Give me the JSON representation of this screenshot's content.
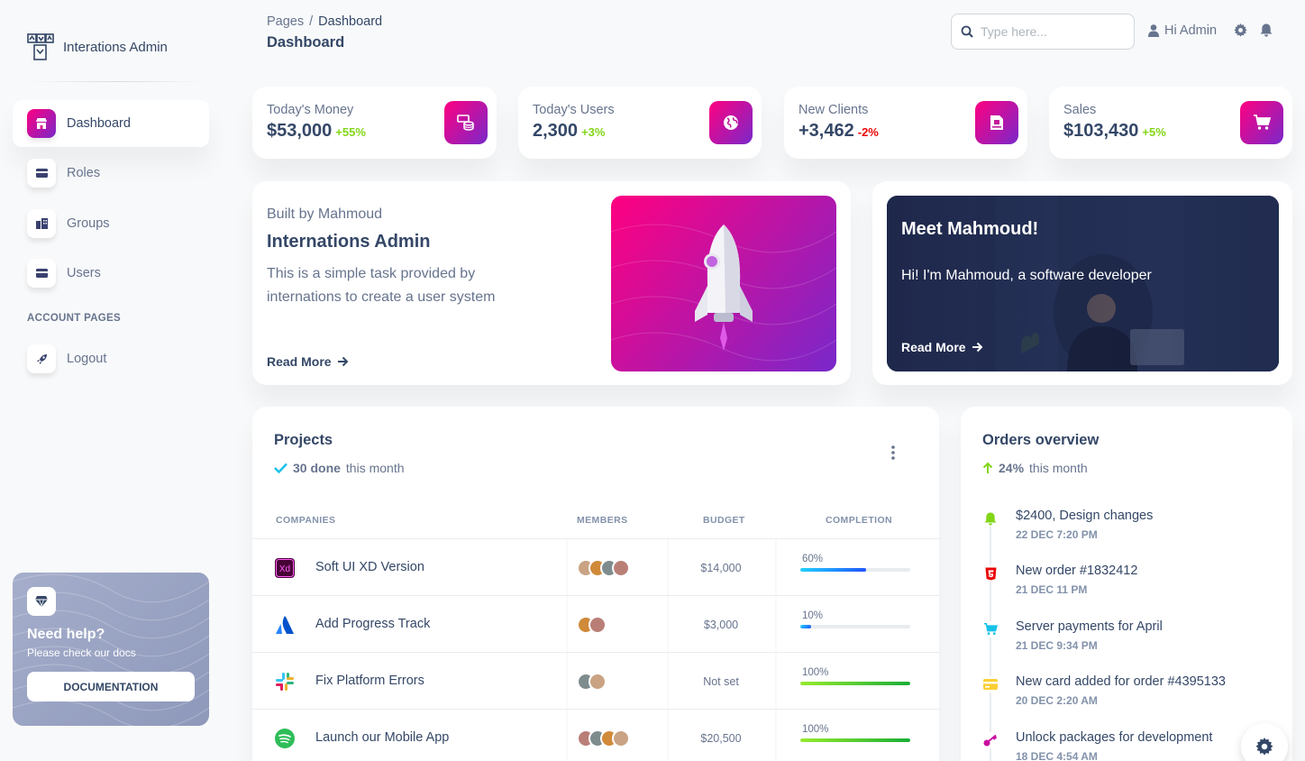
{
  "brand": {
    "name": "Interations Admin",
    "icon": "grid-logo-icon"
  },
  "sidebar": {
    "items": [
      {
        "label": "Dashboard",
        "icon": "shop-icon",
        "active": true
      },
      {
        "label": "Roles",
        "icon": "credit-card-icon",
        "active": false
      },
      {
        "label": "Groups",
        "icon": "office-building-icon",
        "active": false
      },
      {
        "label": "Users",
        "icon": "credit-card-icon",
        "active": false
      }
    ],
    "section_label": "ACCOUNT PAGES",
    "account_items": [
      {
        "label": "Logout",
        "icon": "rocket-icon"
      }
    ],
    "help": {
      "title": "Need help?",
      "subtitle": "Please check our docs",
      "button": "DOCUMENTATION",
      "icon": "diamond-icon"
    }
  },
  "header": {
    "breadcrumb_root": "Pages",
    "breadcrumb_sep": "/",
    "breadcrumb_current": "Dashboard",
    "title": "Dashboard",
    "search_placeholder": "Type here...",
    "user_label": "Hi Admin"
  },
  "stats": [
    {
      "title": "Today's Money",
      "value": "$53,000",
      "change": "+55%",
      "positive": true,
      "icon": "money-icon"
    },
    {
      "title": "Today's Users",
      "value": "2,300",
      "change": "+3%",
      "positive": true,
      "icon": "globe-icon"
    },
    {
      "title": "New Clients",
      "value": "+3,462",
      "change": "-2%",
      "positive": false,
      "icon": "document-icon"
    },
    {
      "title": "Sales",
      "value": "$103,430",
      "change": "+5%",
      "positive": true,
      "icon": "cart-icon"
    }
  ],
  "built": {
    "subtitle": "Built by Mahmoud",
    "title": "Internations Admin",
    "description": "This is a simple task provided by internations to create a user system",
    "link": "Read More"
  },
  "meet": {
    "title": "Meet Mahmoud!",
    "description": "Hi! I'm Mahmoud, a software developer",
    "link": "Read More"
  },
  "projects": {
    "title": "Projects",
    "done_count": "30 done",
    "done_suffix": "this month",
    "columns": [
      "COMPANIES",
      "MEMBERS",
      "BUDGET",
      "COMPLETION"
    ],
    "rows": [
      {
        "name": "Soft UI XD Version",
        "logo": "adobe-xd-icon",
        "members": 4,
        "budget": "$14,000",
        "completion": "60%",
        "progress": 0.6,
        "color": "blue"
      },
      {
        "name": "Add Progress Track",
        "logo": "atlassian-icon",
        "members": 2,
        "budget": "$3,000",
        "completion": "10%",
        "progress": 0.1,
        "color": "blue"
      },
      {
        "name": "Fix Platform Errors",
        "logo": "slack-icon",
        "members": 2,
        "budget": "Not set",
        "completion": "100%",
        "progress": 1.0,
        "color": "green"
      },
      {
        "name": "Launch our Mobile App",
        "logo": "spotify-icon",
        "members": 4,
        "budget": "$20,500",
        "completion": "100%",
        "progress": 1.0,
        "color": "green"
      }
    ]
  },
  "orders": {
    "title": "Orders overview",
    "change": "24%",
    "change_suffix": "this month",
    "items": [
      {
        "title": "$2400, Design changes",
        "date": "22 DEC 7:20 PM",
        "icon": "bell-icon",
        "color": "#82d616"
      },
      {
        "title": "New order #1832412",
        "date": "21 DEC 11 PM",
        "icon": "html5-icon",
        "color": "#ea0606"
      },
      {
        "title": "Server payments for April",
        "date": "21 DEC 9:34 PM",
        "icon": "cart-icon",
        "color": "#17c1e8"
      },
      {
        "title": "New card added for order #4395133",
        "date": "20 DEC 2:20 AM",
        "icon": "credit-card-icon",
        "color": "#fbcf33"
      },
      {
        "title": "Unlock packages for development",
        "date": "18 DEC 4:54 AM",
        "icon": "key-icon",
        "color": "#cb0c9f"
      }
    ]
  },
  "colors": {
    "accent_start": "#7928ca",
    "accent_end": "#ff0080",
    "text": "#344767",
    "muted": "#67748e",
    "success": "#82d616",
    "danger": "#ea0606"
  }
}
